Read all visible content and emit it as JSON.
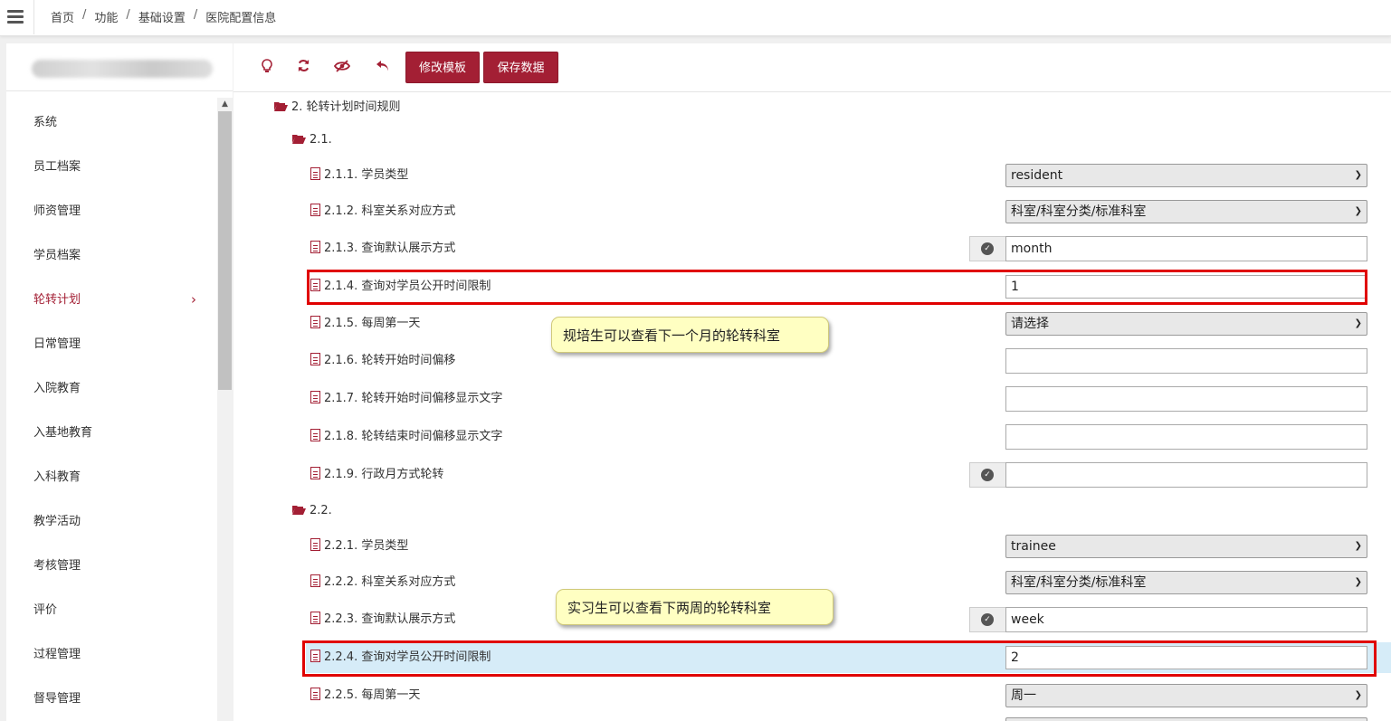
{
  "breadcrumb": [
    "首页",
    "功能",
    "基础设置",
    "医院配置信息"
  ],
  "breadcrumb_sep": "/",
  "sidebar": {
    "items": [
      {
        "label": "系统"
      },
      {
        "label": "员工档案"
      },
      {
        "label": "师资管理"
      },
      {
        "label": "学员档案"
      },
      {
        "label": "轮转计划",
        "active": true
      },
      {
        "label": "日常管理"
      },
      {
        "label": "入院教育"
      },
      {
        "label": "入基地教育"
      },
      {
        "label": "入科教育"
      },
      {
        "label": "教学活动"
      },
      {
        "label": "考核管理"
      },
      {
        "label": "评价"
      },
      {
        "label": "过程管理"
      },
      {
        "label": "督导管理"
      }
    ]
  },
  "toolbar": {
    "icons": [
      "lightbulb-icon",
      "refresh-icon",
      "eye-slash-icon",
      "undo-icon"
    ],
    "edit_template": "修改模板",
    "save_data": "保存数据"
  },
  "tree": {
    "root": "2. 轮转计划时间规则",
    "group1": {
      "label": "2.1.",
      "items": [
        {
          "label": "2.1.1. 学员类型",
          "type": "select",
          "value": "resident"
        },
        {
          "label": "2.1.2. 科室关系对应方式",
          "type": "select",
          "value": "科室/科室分类/标准科室"
        },
        {
          "label": "2.1.3. 查询默认展示方式",
          "type": "input-check",
          "value": "month"
        },
        {
          "label": "2.1.4. 查询对学员公开时间限制",
          "type": "input",
          "value": "1"
        },
        {
          "label": "2.1.5. 每周第一天",
          "type": "select",
          "value": "请选择"
        },
        {
          "label": "2.1.6. 轮转开始时间偏移",
          "type": "input",
          "value": ""
        },
        {
          "label": "2.1.7. 轮转开始时间偏移显示文字",
          "type": "input",
          "value": ""
        },
        {
          "label": "2.1.8. 轮转结束时间偏移显示文字",
          "type": "input",
          "value": ""
        },
        {
          "label": "2.1.9. 行政月方式轮转",
          "type": "input-check",
          "value": ""
        }
      ]
    },
    "group2": {
      "label": "2.2.",
      "items": [
        {
          "label": "2.2.1. 学员类型",
          "type": "select",
          "value": "trainee"
        },
        {
          "label": "2.2.2. 科室关系对应方式",
          "type": "select",
          "value": "科室/科室分类/标准科室"
        },
        {
          "label": "2.2.3. 查询默认展示方式",
          "type": "input-check",
          "value": "week"
        },
        {
          "label": "2.2.4. 查询对学员公开时间限制",
          "type": "input",
          "value": "2",
          "selected": true
        },
        {
          "label": "2.2.5. 每周第一天",
          "type": "select",
          "value": "周一"
        }
      ]
    }
  },
  "callouts": {
    "resident_note": "规培生可以查看下一个月的轮转科室",
    "trainee_note": "实习生可以查看下两周的轮转科室"
  },
  "colors": {
    "accent": "#a31f34",
    "highlight_box": "#e00000",
    "callout_bg": "#ffffc2",
    "selected_row": "#d6ecf8"
  }
}
